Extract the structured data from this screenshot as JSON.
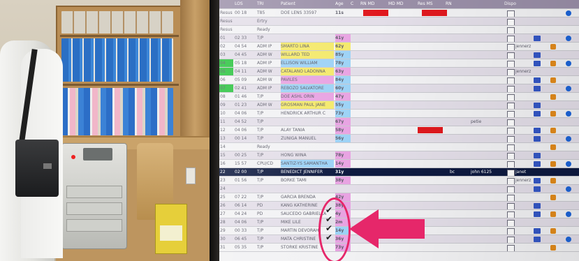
{
  "screen": {
    "header": {
      "bed": "",
      "los": "LOS",
      "triage": "TRI",
      "patient": "Patient",
      "age": "Age",
      "c": "C",
      "rn": "RN MD",
      "md": "MD MD",
      "res": "Res MS",
      "x": "RN",
      "dispo": "Dispo"
    },
    "rows": [
      {
        "bed": "Resus A",
        "los": "00 18",
        "tri": "T85",
        "pat": "DOE LENS 33597",
        "age": "11s",
        "hl": "red",
        "red1": true
      },
      {
        "bed": "Resus B",
        "los": "",
        "tri": "Ertry",
        "pat": "",
        "age": "",
        "alt": true
      },
      {
        "bed": "Resus C",
        "los": "",
        "tri": "Ready",
        "pat": "",
        "age": ""
      },
      {
        "bed": "01",
        "los": "02 33",
        "tri": "T/P",
        "pat": "",
        "age": "41y",
        "ageHl": "p"
      },
      {
        "bed": "02",
        "los": "04 54",
        "tri": "ADM IP",
        "pat": "SMARTO LINA",
        "age": "62y",
        "ageHl": "y",
        "patHl": "y"
      },
      {
        "bed": "03",
        "los": "04 45",
        "tri": "ADM W",
        "pat": "WILLARD TED",
        "age": "85y",
        "ageHl": "b",
        "patHl": "y"
      },
      {
        "bed": "04",
        "los": "05 18",
        "tri": "ADM IP",
        "pat": "ELLISON WILLIAM",
        "age": "78y",
        "ageHl": "b",
        "patHl": "b",
        "green": true
      },
      {
        "bed": "05",
        "los": "04 11",
        "tri": "ADM W",
        "pat": "CATALANO LADONNA",
        "age": "63y",
        "ageHl": "p",
        "patHl": "y",
        "green": true
      },
      {
        "bed": "06",
        "los": "05 09",
        "tri": "ADM W",
        "pat": "PAVILES",
        "age": "84y",
        "ageHl": "b",
        "patHl": "p"
      },
      {
        "bed": "07",
        "los": "02 41",
        "tri": "ADM IP",
        "pat": "REBOZO SALVATORE",
        "age": "60y",
        "ageHl": "b",
        "patHl": "b",
        "green": true
      },
      {
        "bed": "08",
        "los": "01 46",
        "tri": "T/P",
        "pat": "DOE ASHL ORIN",
        "age": "47y",
        "ageHl": "p",
        "patHl": "p"
      },
      {
        "bed": "09",
        "los": "01 23",
        "tri": "ADM W",
        "pat": "GROSMAN PAUL JANE",
        "age": "55y",
        "ageHl": "b",
        "patHl": "y"
      },
      {
        "bed": "10",
        "los": "04 06",
        "tri": "T/P",
        "pat": "HENDRICK ARTHUR C",
        "age": "73y",
        "ageHl": "b"
      },
      {
        "bed": "11",
        "los": "04 52",
        "tri": "T/P",
        "pat": "",
        "age": "67y",
        "ageHl": "p"
      },
      {
        "bed": "12",
        "los": "04 06",
        "tri": "T/P",
        "pat": "ALAY TANIA",
        "age": "58y",
        "ageHl": "p",
        "red2": true
      },
      {
        "bed": "13",
        "los": "00 14",
        "tri": "T/P",
        "pat": "ZUNIGA MANUEL",
        "age": "56y",
        "ageHl": "b"
      },
      {
        "bed": "14",
        "los": "",
        "tri": "Ready",
        "pat": "",
        "age": ""
      },
      {
        "bed": "15",
        "los": "00 25",
        "tri": "T/P",
        "pat": "HONG WINA",
        "age": "78y",
        "ageHl": "p"
      },
      {
        "bed": "16",
        "los": "15 57",
        "tri": "CPU/CD",
        "pat": "SANTIZ-YS SAMANTHA",
        "age": "14y",
        "ageHl": "p",
        "patHl": "b"
      },
      {
        "bed": "22",
        "los": "02 00",
        "tri": "T/P",
        "pat": "BENEDICT JENNIFER",
        "age": "31y",
        "sel": true
      },
      {
        "bed": "23",
        "los": "01 56",
        "tri": "T/P",
        "pat": "BORKE TAMI",
        "age": "38y",
        "ageHl": "p"
      },
      {
        "bed": "24",
        "los": "",
        "tri": "",
        "pat": "",
        "age": ""
      },
      {
        "bed": "25",
        "los": "07 22",
        "tri": "T/P",
        "pat": "GARCIA BRENDA",
        "age": "42y",
        "ageHl": "p"
      },
      {
        "bed": "26",
        "los": "06 14",
        "tri": "PD",
        "pat": "KANG KATHERINE",
        "age": "38y",
        "ageHl": "p"
      },
      {
        "bed": "27",
        "los": "04 24",
        "tri": "PD",
        "pat": "SAUCEDO GABRIELLA",
        "age": "4y",
        "ageHl": "p"
      },
      {
        "bed": "28",
        "los": "04 06",
        "tri": "T/P",
        "pat": "MIKE LILE",
        "age": "2m",
        "ageHl": "p"
      },
      {
        "bed": "29",
        "los": "00 33",
        "tri": "T/P",
        "pat": "MARTIN DEVORAH",
        "age": "14y",
        "ageHl": "b"
      },
      {
        "bed": "30",
        "los": "06 45",
        "tri": "T/P",
        "pat": "MATA CHRISTINE",
        "age": "36y",
        "ageHl": "p"
      },
      {
        "bed": "31",
        "los": "05 35",
        "tri": "T/P",
        "pat": "STORKE KRISTINE",
        "age": "73y",
        "ageHl": "p"
      }
    ],
    "nurses": [
      "",
      "",
      "",
      "",
      "jennerz",
      "",
      "",
      "jennerz",
      "",
      "",
      "",
      "",
      "",
      "",
      "",
      "",
      "",
      "",
      "",
      "janet",
      "jennerz",
      "",
      "",
      "",
      "",
      "",
      "",
      "",
      ""
    ],
    "staff": [
      "",
      "",
      "",
      "",
      "",
      "",
      "",
      "",
      "",
      "",
      "",
      "",
      "",
      "petie",
      "",
      "",
      "",
      "",
      "",
      "john 6125",
      "",
      "",
      "",
      "",
      "",
      "",
      "",
      "",
      ""
    ],
    "extra_label": "bc"
  },
  "annotation": {
    "checkmark": "✔",
    "arrow_color": "#e6276a"
  },
  "colors": {
    "red": "#e0181e",
    "green": "#27c33c",
    "select": "#0e1a40"
  }
}
